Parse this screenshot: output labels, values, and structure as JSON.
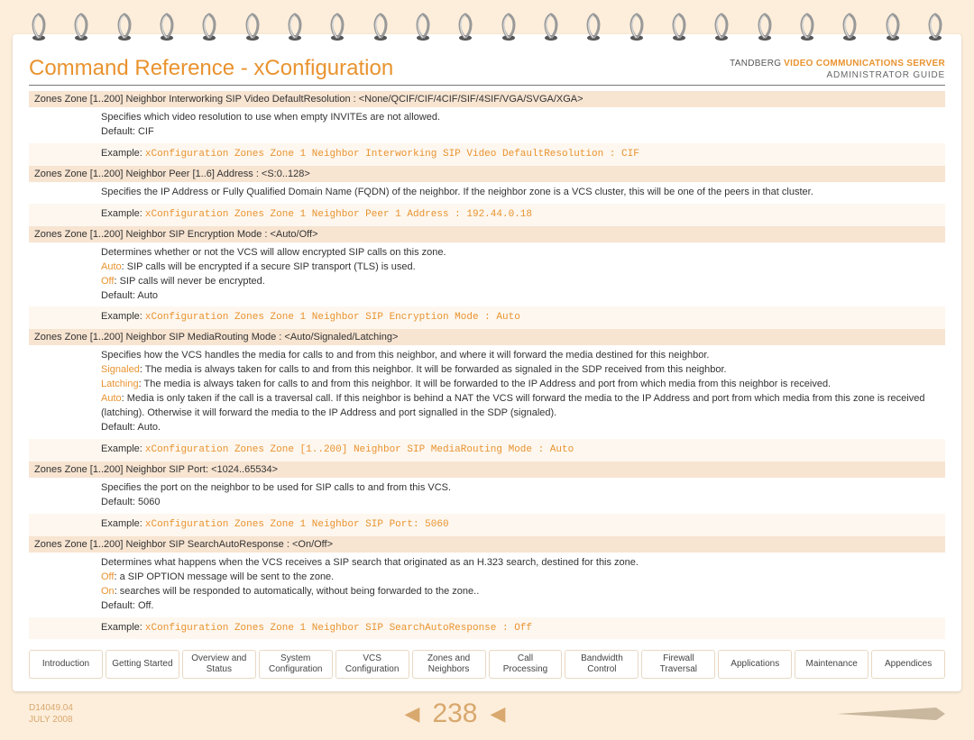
{
  "header": {
    "title": "Command Reference - xConfiguration",
    "brand_static": "TANDBERG",
    "brand_product": "VIDEO COMMUNICATIONS SERVER",
    "brand_sub": "ADMINISTRATOR GUIDE"
  },
  "commands": [
    {
      "name": "Zones Zone [1..200] Neighbor Interworking SIP Video DefaultResolution : <None/QCIF/CIF/4CIF/SIF/4SIF/VGA/SVGA/XGA>",
      "rows": [
        {
          "alt": false,
          "segments": [
            {
              "t": "Specifies which video resolution to use when empty INVITEs are not allowed."
            }
          ],
          "br": true,
          "segments2": [
            {
              "t": "Default: CIF"
            }
          ]
        },
        {
          "alt": true,
          "segments": [
            {
              "t": "Example: "
            },
            {
              "t": "xConfiguration Zones Zone 1 Neighbor Interworking SIP Video DefaultResolution : CIF",
              "cls": "hl mono"
            }
          ]
        }
      ]
    },
    {
      "name": "Zones Zone [1..200] Neighbor Peer [1..6] Address : <S:0..128>",
      "rows": [
        {
          "alt": false,
          "segments": [
            {
              "t": "Specifies the IP Address or Fully Qualified Domain Name (FQDN) of the neighbor. If the neighbor zone is a VCS cluster, this will be one of the peers in that cluster."
            }
          ]
        },
        {
          "alt": true,
          "segments": [
            {
              "t": "Example: "
            },
            {
              "t": "xConfiguration Zones Zone 1 Neighbor Peer 1 Address : 192.44.0.18",
              "cls": "hl mono"
            }
          ]
        }
      ]
    },
    {
      "name": "Zones Zone [1..200] Neighbor SIP Encryption Mode : <Auto/Off>",
      "rows": [
        {
          "alt": false,
          "lines": [
            [
              {
                "t": "Determines whether or not the VCS will allow encrypted SIP calls on this zone."
              }
            ],
            [
              {
                "t": "Auto",
                "cls": "hl"
              },
              {
                "t": ": SIP calls will be encrypted if a secure SIP transport (TLS) is used."
              }
            ],
            [
              {
                "t": "Off",
                "cls": "hl"
              },
              {
                "t": ": SIP calls will never be encrypted."
              }
            ],
            [
              {
                "t": "Default: Auto"
              }
            ]
          ]
        },
        {
          "alt": true,
          "segments": [
            {
              "t": "Example: "
            },
            {
              "t": "xConfiguration Zones Zone 1 Neighbor SIP Encryption Mode : Auto",
              "cls": "hl mono"
            }
          ]
        }
      ]
    },
    {
      "name": "Zones Zone [1..200] Neighbor SIP MediaRouting Mode : <Auto/Signaled/Latching>",
      "rows": [
        {
          "alt": false,
          "lines": [
            [
              {
                "t": "Specifies how the VCS handles the media for calls to and from this neighbor, and where it will forward the media destined for this neighbor."
              }
            ],
            [
              {
                "t": "Signaled",
                "cls": "hl"
              },
              {
                "t": ": The media is always taken for calls to and from this neighbor. It will be forwarded as signaled in the SDP received from this neighbor."
              }
            ],
            [
              {
                "t": "Latching",
                "cls": "hl"
              },
              {
                "t": ": The media is always taken for calls to and from this neighbor. It will be forwarded to the IP Address and port from which media from this neighbor is received."
              }
            ],
            [
              {
                "t": "Auto",
                "cls": "hl"
              },
              {
                "t": ": Media is only taken if the call is a traversal call. If this neighbor is behind a NAT the VCS will forward the media to the IP Address and port from which media from this zone is received (latching).  Otherwise it will forward the media to the IP Address and port signalled in the SDP (signaled)."
              }
            ],
            [
              {
                "t": "Default: Auto."
              }
            ]
          ]
        },
        {
          "alt": true,
          "segments": [
            {
              "t": "Example: "
            },
            {
              "t": "xConfiguration Zones Zone [1..200] Neighbor SIP MediaRouting Mode : Auto",
              "cls": "hl mono"
            }
          ]
        }
      ]
    },
    {
      "name": "Zones Zone [1..200] Neighbor SIP Port: <1024..65534>",
      "rows": [
        {
          "alt": false,
          "lines": [
            [
              {
                "t": "Specifies the port on the neighbor to be used for SIP calls to and from this VCS."
              }
            ],
            [
              {
                "t": "Default: 5060"
              }
            ]
          ]
        },
        {
          "alt": true,
          "segments": [
            {
              "t": "Example: "
            },
            {
              "t": "xConfiguration Zones Zone 1 Neighbor SIP Port: 5060",
              "cls": "hl mono"
            }
          ]
        }
      ]
    },
    {
      "name": "Zones Zone [1..200] Neighbor SIP SearchAutoResponse : <On/Off>",
      "rows": [
        {
          "alt": false,
          "lines": [
            [
              {
                "t": "Determines what happens when the VCS receives a SIP search that originated as an H.323 search, destined for this zone."
              }
            ],
            [
              {
                "t": "Off",
                "cls": "hl"
              },
              {
                "t": ": a SIP OPTION message will be sent to the zone."
              }
            ],
            [
              {
                "t": "On",
                "cls": "hl"
              },
              {
                "t": ": searches will be responded to automatically, without being forwarded to the zone.."
              }
            ],
            [
              {
                "t": "Default: Off."
              }
            ]
          ]
        },
        {
          "alt": true,
          "segments": [
            {
              "t": "Example: "
            },
            {
              "t": "xConfiguration Zones Zone 1 Neighbor SIP SearchAutoResponse : Off",
              "cls": "hl mono"
            }
          ]
        }
      ]
    }
  ],
  "nav": [
    {
      "l1": "Introduction"
    },
    {
      "l1": "Getting Started"
    },
    {
      "l1": "Overview and",
      "l2": "Status"
    },
    {
      "l1": "System",
      "l2": "Configuration"
    },
    {
      "l1": "VCS",
      "l2": "Configuration"
    },
    {
      "l1": "Zones and",
      "l2": "Neighbors"
    },
    {
      "l1": "Call",
      "l2": "Processing"
    },
    {
      "l1": "Bandwidth",
      "l2": "Control"
    },
    {
      "l1": "Firewall",
      "l2": "Traversal"
    },
    {
      "l1": "Applications"
    },
    {
      "l1": "Maintenance"
    },
    {
      "l1": "Appendices"
    }
  ],
  "footer": {
    "doc_id": "D14049.04",
    "date": "JULY 2008",
    "page": "238"
  }
}
